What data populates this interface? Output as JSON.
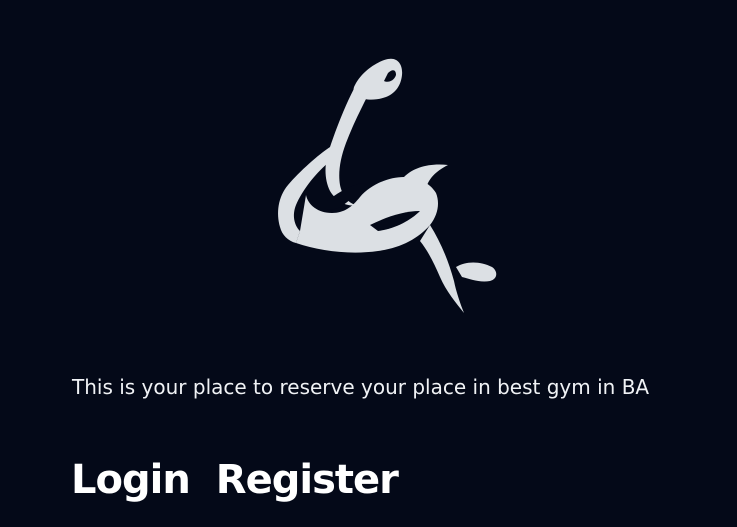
{
  "hero": {
    "logo_icon": "flexed-arm-icon",
    "logo_color": "#dce0e4",
    "background_color": "#040918",
    "tagline": "This is your place to reserve your place in best gym in BA"
  },
  "nav": {
    "login_label": "Login",
    "register_label": "Register"
  }
}
